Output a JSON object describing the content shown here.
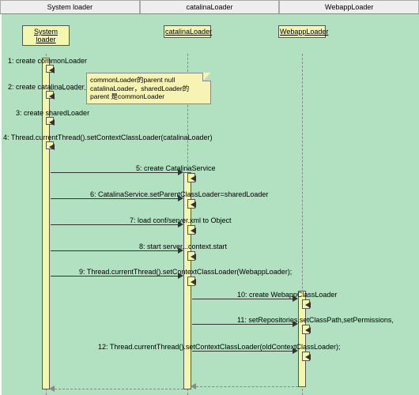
{
  "tabs": [
    "System loader",
    "catalinaLoader",
    "WebappLoader"
  ],
  "participants": {
    "p1": "System loader",
    "p2": "catalinaLoader",
    "p3": "WebappLoader"
  },
  "note_line1": "commonLoader的parent null",
  "note_line2": "catalinaLoader，sharedLoader的",
  "note_line3": "parent 是commonLoader",
  "messages": {
    "m1": "1: create commonLoader",
    "m2": "2: create catalinaLoader",
    "m3": "3: create sharedLoader",
    "m4": "4: Thread.currentThread().setContextClassLoader(catalinaLoader)",
    "m5": "5: create CatalinaService",
    "m6": "6: CatalinaService.setParentClassLoader=sharedLoader",
    "m7": "7: load conf/server.xml to Object",
    "m8": "8: start server...context.start",
    "m9": "9: Thread.currentThread().setContextClassLoader(WebappLoader);",
    "m10": "10: create WebappClassLoader",
    "m11": "11: setRepositories,setClassPath,setPermissions,",
    "m12": "12: Thread.currentThread().setContextClassLoader(oldContextClassLoader);"
  }
}
